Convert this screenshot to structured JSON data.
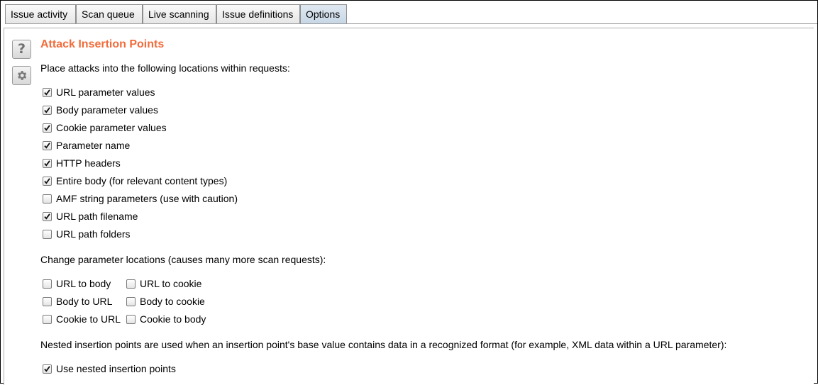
{
  "tabs": [
    {
      "label": "Issue activity",
      "active": false
    },
    {
      "label": "Scan queue",
      "active": false
    },
    {
      "label": "Live scanning",
      "active": false
    },
    {
      "label": "Issue definitions",
      "active": false
    },
    {
      "label": "Options",
      "active": true
    }
  ],
  "side_buttons": {
    "help": {
      "icon": "help-icon",
      "glyph": "?"
    },
    "settings": {
      "icon": "gear-icon"
    }
  },
  "section": {
    "title": "Attack Insertion Points",
    "title_color": "#f26b3a"
  },
  "locations": {
    "heading": "Place attacks into the following locations within requests:",
    "items": [
      {
        "label": "URL parameter values",
        "checked": true
      },
      {
        "label": "Body parameter values",
        "checked": true
      },
      {
        "label": "Cookie parameter values",
        "checked": true
      },
      {
        "label": "Parameter name",
        "checked": true
      },
      {
        "label": "HTTP headers",
        "checked": true
      },
      {
        "label": "Entire body (for relevant content types)",
        "checked": true
      },
      {
        "label": "AMF string parameters (use with caution)",
        "checked": false
      },
      {
        "label": "URL path filename",
        "checked": true
      },
      {
        "label": "URL path folders",
        "checked": false
      }
    ]
  },
  "change_locations": {
    "heading": "Change parameter locations (causes many more scan requests):",
    "col1": [
      {
        "label": "URL to body",
        "checked": false
      },
      {
        "label": "Body to URL",
        "checked": false
      },
      {
        "label": "Cookie to URL",
        "checked": false
      }
    ],
    "col2": [
      {
        "label": "URL to cookie",
        "checked": false
      },
      {
        "label": "Body to cookie",
        "checked": false
      },
      {
        "label": "Cookie to body",
        "checked": false
      }
    ]
  },
  "nested": {
    "description": "Nested insertion points are used when an insertion point's base value contains data in a recognized format (for example, XML data within a URL parameter):",
    "item": {
      "label": "Use nested insertion points",
      "checked": true
    }
  }
}
